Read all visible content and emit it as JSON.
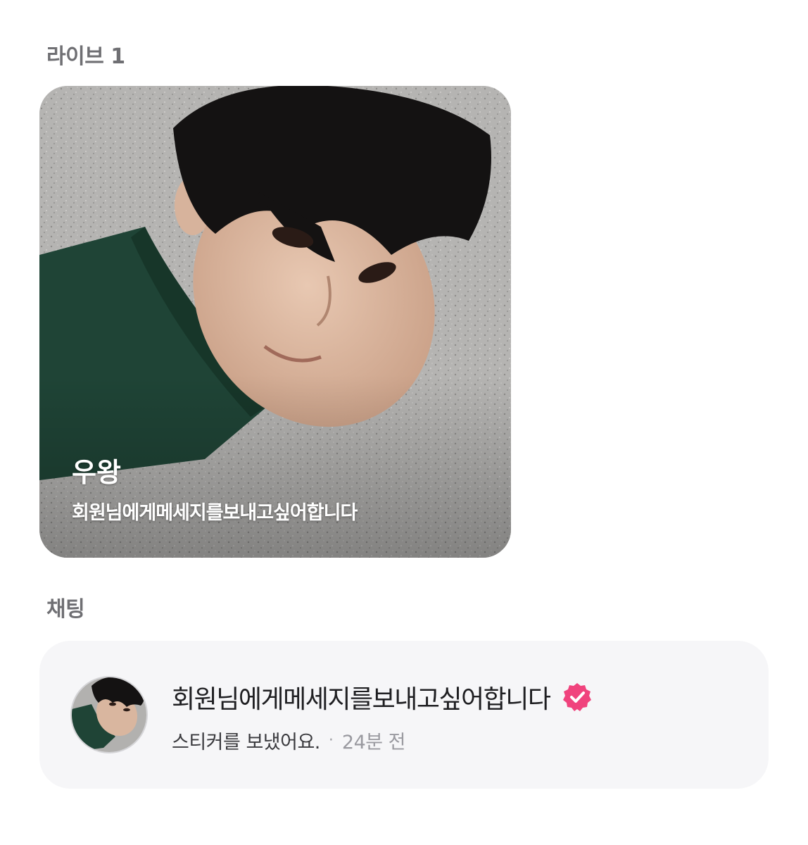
{
  "live_section": {
    "title": "라이브 1"
  },
  "live_card": {
    "name": "우왕",
    "subtitle": "회원님에게메세지를보내고싶어합니다"
  },
  "chat_section": {
    "title": "채팅"
  },
  "chat_item": {
    "name": "회원님에게메세지를보내고싶어합니다",
    "verified_icon": "verified-badge-icon",
    "verified_color": "#f0437d",
    "preview": "스티커를 보냈어요.",
    "separator": "·",
    "time": "24분 전"
  }
}
